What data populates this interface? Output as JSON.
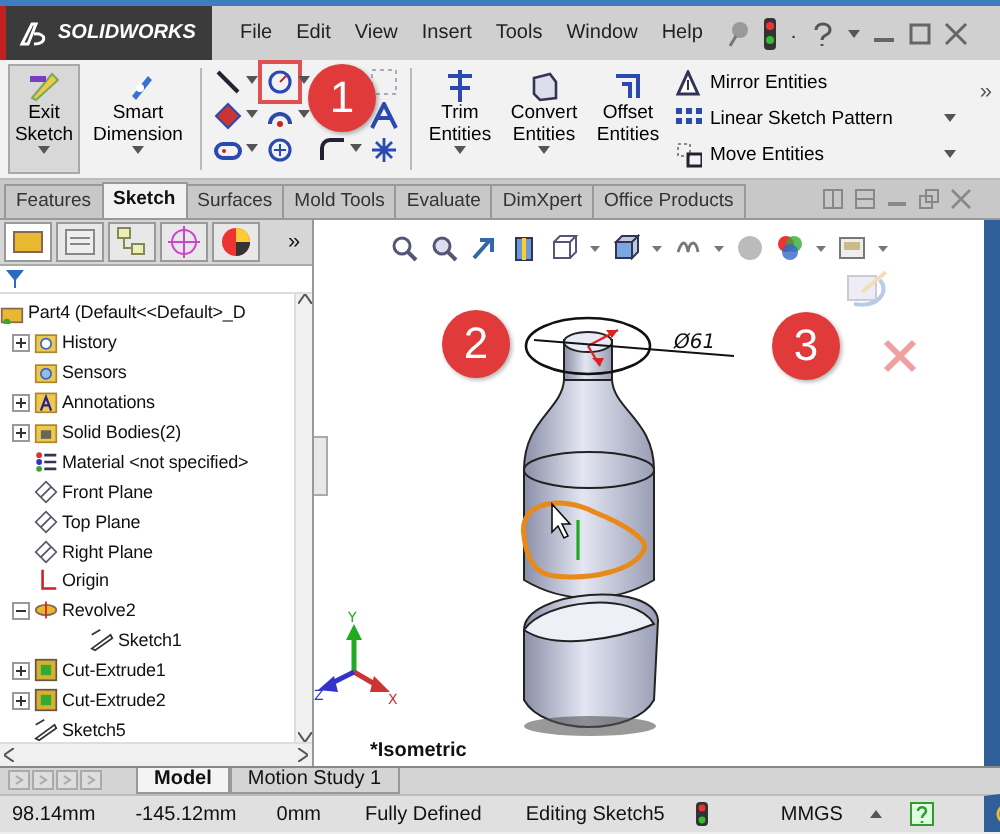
{
  "title_bar": {
    "logo": "SOLIDWORKS",
    "menus": [
      "File",
      "Edit",
      "View",
      "Insert",
      "Tools",
      "Window",
      "Help"
    ],
    "separator": "."
  },
  "ribbon": {
    "big_buttons": [
      {
        "label": "Exit Sketch",
        "pressed": true
      },
      {
        "label": "Smart Dimension",
        "pressed": false
      }
    ],
    "edit_buttons": [
      "Trim Entities",
      "Convert Entities",
      "Offset Entities"
    ],
    "list": [
      {
        "label": "Mirror Entities",
        "dropdown": false
      },
      {
        "label": "Linear Sketch Pattern",
        "dropdown": true
      },
      {
        "label": "Move Entities",
        "dropdown": true
      }
    ],
    "more": "»"
  },
  "tabs": [
    {
      "label": "Features",
      "selected": false
    },
    {
      "label": "Sketch",
      "selected": true
    },
    {
      "label": "Surfaces",
      "selected": false
    },
    {
      "label": "Mold Tools",
      "selected": false
    },
    {
      "label": "Evaluate",
      "selected": false
    },
    {
      "label": "DimXpert",
      "selected": false
    },
    {
      "label": "Office Products",
      "selected": false
    }
  ],
  "panel": {
    "tabs": [
      {
        "selected": true
      },
      {
        "selected": false
      },
      {
        "selected": false
      },
      {
        "selected": false
      },
      {
        "selected": false
      }
    ],
    "more": "»",
    "tree": {
      "label": "Part4  (Default<<Default>_D",
      "kind": "part",
      "children": [
        {
          "label": "History",
          "kind": "history",
          "expanded": false
        },
        {
          "label": "Sensors",
          "kind": "sensor"
        },
        {
          "label": "Annotations",
          "kind": "annotation",
          "expanded": false
        },
        {
          "label": "Solid Bodies(2)",
          "kind": "folder",
          "expanded": false
        },
        {
          "label": "Material <not specified>",
          "kind": "material"
        },
        {
          "label": "Front Plane",
          "kind": "plane"
        },
        {
          "label": "Top Plane",
          "kind": "plane"
        },
        {
          "label": "Right Plane",
          "kind": "plane"
        },
        {
          "label": "Origin",
          "kind": "origin"
        },
        {
          "label": "Revolve2",
          "kind": "revolve",
          "expanded": true,
          "children": [
            {
              "label": "Sketch1",
              "kind": "sketch"
            }
          ]
        },
        {
          "label": "Cut-Extrude1",
          "kind": "cut",
          "expanded": false
        },
        {
          "label": "Cut-Extrude2",
          "kind": "cut",
          "expanded": false
        },
        {
          "label": "Sketch5",
          "kind": "sketch"
        }
      ]
    }
  },
  "viewport": {
    "dimension": "Ø61",
    "axes": [
      "Y",
      "Z",
      "X"
    ],
    "view_name": "*Isometric"
  },
  "callouts": [
    "1",
    "2",
    "3"
  ],
  "bottom_tabs": [
    {
      "label": "Model",
      "selected": true
    },
    {
      "label": "Motion Study 1",
      "selected": false
    }
  ],
  "status_bar": {
    "readouts": [
      "98.14mm",
      "-145.12mm",
      "0mm",
      "Fully Defined",
      "Editing Sketch5"
    ],
    "units": "MMGS"
  }
}
